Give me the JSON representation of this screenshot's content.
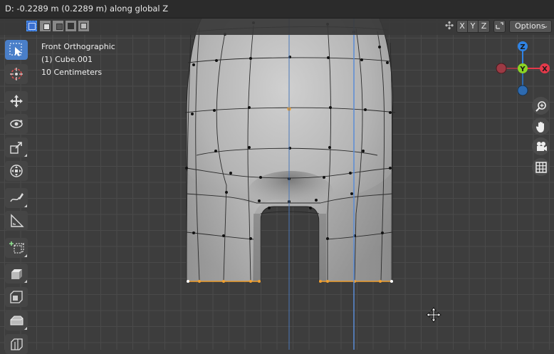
{
  "header": {
    "status_text": "D: -0.2289 m (0.2289 m) along global Z"
  },
  "overlay": {
    "view_name": "Front Orthographic",
    "object_name": "(1) Cube.001",
    "grid_scale": "10 Centimeters"
  },
  "header_right": {
    "axis_x": "X",
    "axis_y": "Y",
    "axis_z": "Z",
    "options_label": "Options"
  },
  "selection_modes": [
    "new-selection",
    "extend-selection",
    "subtract-selection",
    "difference-selection",
    "intersect-selection"
  ],
  "toolbar": {
    "tools": [
      "select-box",
      "cursor",
      "move",
      "rotate",
      "scale",
      "transform",
      "annotate",
      "measure",
      "add-cube",
      "extrude-region",
      "inset-faces",
      "bevel",
      "loop-cut"
    ],
    "active_tool": "select-box"
  },
  "gizmo": {
    "z_label": "Z",
    "y_label": "Y",
    "x_label": "X",
    "colors": {
      "x": "#e5394a",
      "y": "#8bd424",
      "z": "#2f83e4",
      "neg_x": "#9c3a44",
      "neg_z": "#2d6ab0"
    }
  },
  "nav_buttons": [
    "zoom-icon",
    "pan-hand-icon",
    "camera-icon",
    "grid-icon"
  ],
  "colors": {
    "viewport_bg": "#3d3d3d",
    "header_bg": "#2b2b2b",
    "active_tool": "#4a7fc9",
    "selected_vertex": "#f0a030",
    "axis_line": "#5a8cd6"
  }
}
